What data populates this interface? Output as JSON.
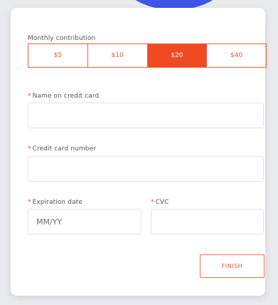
{
  "form": {
    "contribution_label": "Monthly contribution",
    "amounts": [
      {
        "label": "$5",
        "selected": false
      },
      {
        "label": "$10",
        "selected": false
      },
      {
        "label": "$20",
        "selected": true
      },
      {
        "label": "$40",
        "selected": false
      }
    ],
    "name_label": "Name on credit card",
    "name_value": "",
    "card_label": "Credit card number",
    "card_value": "",
    "expiry_label": "Expiration date",
    "expiry_placeholder": "MM/YY",
    "cvc_label": "CVC",
    "cvc_value": "",
    "required_marker": "*",
    "finish_label": "FINISH"
  },
  "colors": {
    "accent": "#f04a23",
    "accent_border": "#ee5a3d",
    "blob": "#3f55e6",
    "background": "#e9eaec"
  }
}
